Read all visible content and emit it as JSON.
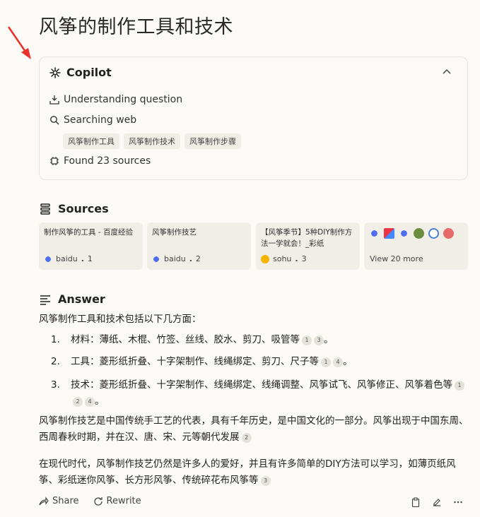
{
  "page": {
    "title": "风筝的制作工具和技术"
  },
  "copilot": {
    "title": "Copilot",
    "steps": [
      "Understanding question",
      "Searching web",
      "Found 23 sources"
    ],
    "chips": [
      "风筝制作工具",
      "风筝制作技术",
      "风筝制作步骤"
    ]
  },
  "sources": {
    "heading": "Sources",
    "items": [
      {
        "title": "制作风筝的工具 - 百度经验",
        "site": "baidu",
        "index": "1"
      },
      {
        "title": "风筝制作技艺",
        "site": "baidu",
        "index": "2"
      },
      {
        "title": "【风筝季节】5种DIY制作方法一学就会！_彩纸",
        "site": "sohu",
        "index": "3"
      }
    ],
    "more_label": "View 20 more"
  },
  "answer": {
    "heading": "Answer",
    "intro": "风筝制作工具和技术包括以下几方面：",
    "list": [
      {
        "num": "1.",
        "text": "材料：薄纸、木棍、竹签、丝线、胶水、剪刀、吸管等",
        "cites": [
          "1",
          "3"
        ],
        "end": "。"
      },
      {
        "num": "2.",
        "text": "工具：菱形纸折叠、十字架制作、线绳绑定、剪刀、尺子等",
        "cites": [
          "1",
          "4"
        ],
        "end": "。"
      },
      {
        "num": "3.",
        "text": "技术：菱形纸折叠、十字架制作、线绳绑定、线绳调整、风筝试飞、风筝修正、风筝着色等",
        "cites": [
          "1",
          "2",
          "4"
        ],
        "end": "。"
      }
    ],
    "para1": "风筝制作技艺是中国传统手工艺的代表，具有千年历史，是中国文化的一部分。风筝出现于中国东周、西周春秋时期，并在汉、唐、宋、元等朝代发展",
    "para1_cite": "2",
    "para2": "在现代时代，风筝制作技艺仍然是许多人的爱好，并且有许多简单的DIY方法可以学习，如薄页纸风筝、彩纸迷你风筝、长方形风筝、传统碎花布风筝等",
    "para2_cite": "3"
  },
  "actions": {
    "share": "Share",
    "rewrite": "Rewrite"
  },
  "colors": {
    "arrow": "#e8312a",
    "background": "#fbfaf6",
    "card": "#f0eee7"
  }
}
